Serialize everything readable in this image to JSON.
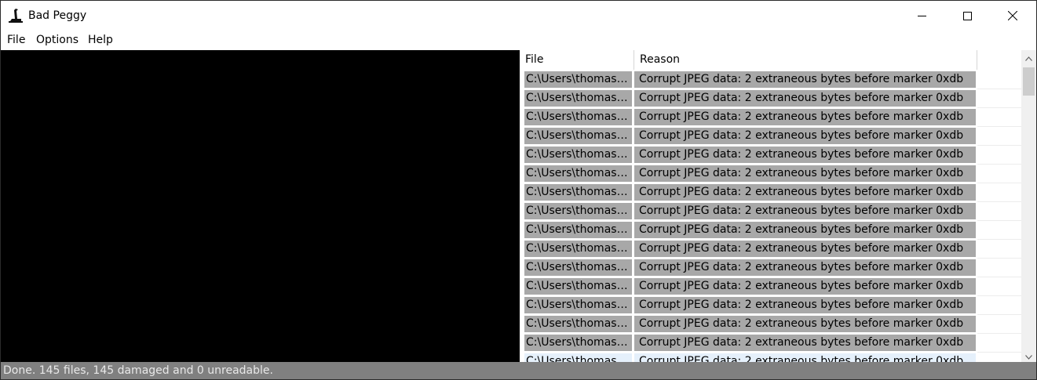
{
  "window": {
    "title": "Bad Peggy"
  },
  "menu": {
    "items": [
      "File",
      "Options",
      "Help"
    ]
  },
  "table": {
    "columns": [
      "File",
      "Reason"
    ],
    "rows": [
      {
        "file": "C:\\Users\\thomasbr...",
        "reason": "Corrupt JPEG data: 2 extraneous bytes before marker 0xdb"
      },
      {
        "file": "C:\\Users\\thomasbr...",
        "reason": "Corrupt JPEG data: 2 extraneous bytes before marker 0xdb"
      },
      {
        "file": "C:\\Users\\thomasbr...",
        "reason": "Corrupt JPEG data: 2 extraneous bytes before marker 0xdb"
      },
      {
        "file": "C:\\Users\\thomasbr...",
        "reason": "Corrupt JPEG data: 2 extraneous bytes before marker 0xdb"
      },
      {
        "file": "C:\\Users\\thomasbr...",
        "reason": "Corrupt JPEG data: 2 extraneous bytes before marker 0xdb"
      },
      {
        "file": "C:\\Users\\thomasbr...",
        "reason": "Corrupt JPEG data: 2 extraneous bytes before marker 0xdb"
      },
      {
        "file": "C:\\Users\\thomasbr...",
        "reason": "Corrupt JPEG data: 2 extraneous bytes before marker 0xdb"
      },
      {
        "file": "C:\\Users\\thomasbr...",
        "reason": "Corrupt JPEG data: 2 extraneous bytes before marker 0xdb"
      },
      {
        "file": "C:\\Users\\thomasbr...",
        "reason": "Corrupt JPEG data: 2 extraneous bytes before marker 0xdb"
      },
      {
        "file": "C:\\Users\\thomasbr...",
        "reason": "Corrupt JPEG data: 2 extraneous bytes before marker 0xdb"
      },
      {
        "file": "C:\\Users\\thomasbr...",
        "reason": "Corrupt JPEG data: 2 extraneous bytes before marker 0xdb"
      },
      {
        "file": "C:\\Users\\thomasbr...",
        "reason": "Corrupt JPEG data: 2 extraneous bytes before marker 0xdb"
      },
      {
        "file": "C:\\Users\\thomasbr...",
        "reason": "Corrupt JPEG data: 2 extraneous bytes before marker 0xdb"
      },
      {
        "file": "C:\\Users\\thomasbr...",
        "reason": "Corrupt JPEG data: 2 extraneous bytes before marker 0xdb"
      },
      {
        "file": "C:\\Users\\thomasbr...",
        "reason": "Corrupt JPEG data: 2 extraneous bytes before marker 0xdb"
      },
      {
        "file": "C:\\Users\\thomasbr...",
        "reason": "Corrupt JPEG data: 2 extraneous bytes before marker 0xdb"
      }
    ]
  },
  "status": {
    "text": "Done. 145 files, 145 damaged and 0 unreadable."
  },
  "icons": {
    "app": "app-logo-icon",
    "minimize": "minimize-icon",
    "maximize": "maximize-icon",
    "close": "close-icon",
    "scroll_up": "chevron-up-icon",
    "scroll_down": "chevron-down-icon"
  },
  "colors": {
    "row_background": "#a8a8a8",
    "statusbar_background": "#808080",
    "preview_background": "#000000"
  }
}
